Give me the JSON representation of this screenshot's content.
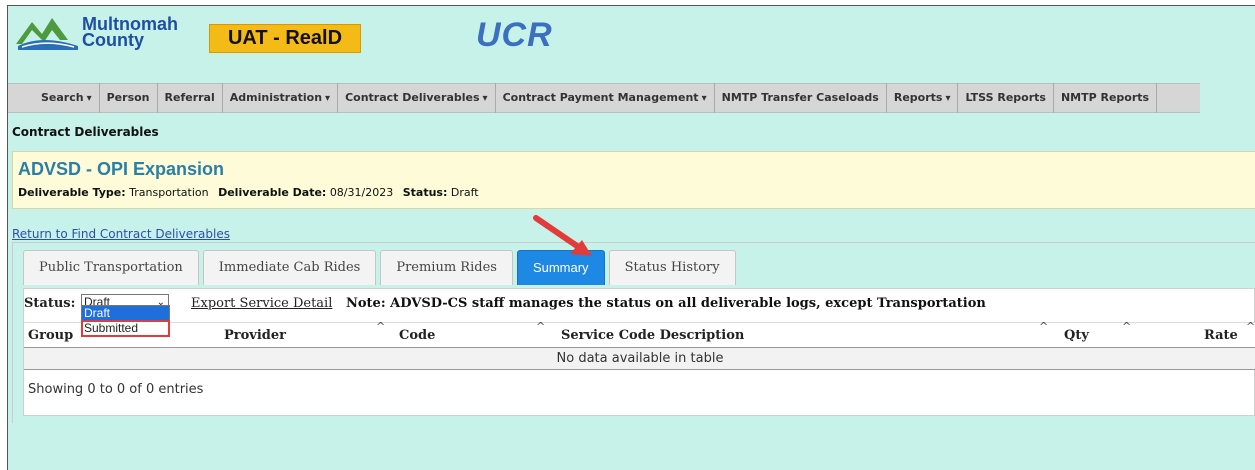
{
  "header": {
    "org_name_line1": "Multnomah",
    "org_name_line2": "County",
    "env_badge": "UAT - RealD",
    "app_title": "UCR"
  },
  "nav": {
    "items": [
      {
        "label": "Search",
        "has_menu": true
      },
      {
        "label": "Person",
        "has_menu": false
      },
      {
        "label": "Referral",
        "has_menu": false
      },
      {
        "label": "Administration",
        "has_menu": true
      },
      {
        "label": "Contract Deliverables",
        "has_menu": true
      },
      {
        "label": "Contract Payment Management",
        "has_menu": true
      },
      {
        "label": "NMTP Transfer Caseloads",
        "has_menu": false
      },
      {
        "label": "Reports",
        "has_menu": true
      },
      {
        "label": "LTSS Reports",
        "has_menu": false
      },
      {
        "label": "NMTP Reports",
        "has_menu": false
      }
    ]
  },
  "page": {
    "heading": "Contract Deliverables",
    "return_link": "Return to Find Contract Deliverables"
  },
  "info": {
    "title": "ADVSD - OPI Expansion",
    "type_label": "Deliverable Type:",
    "type_value": "Transportation",
    "date_label": "Deliverable Date:",
    "date_value": "08/31/2023",
    "status_label": "Status:",
    "status_value": "Draft"
  },
  "tabs": [
    {
      "label": "Public Transportation",
      "active": false
    },
    {
      "label": "Immediate Cab Rides",
      "active": false
    },
    {
      "label": "Premium Rides",
      "active": false
    },
    {
      "label": "Summary",
      "active": true
    },
    {
      "label": "Status History",
      "active": false
    }
  ],
  "summary": {
    "status_label": "Status:",
    "status_selected": "Draft",
    "status_options": [
      "Draft",
      "Submitted"
    ],
    "highlighted_option": "Draft",
    "boxed_option": "Submitted",
    "export_link": "Export Service Detail",
    "note": "Note: ADVSD-CS staff manages the status on all deliverable logs, except Transportation",
    "columns": [
      "Group",
      "Provider",
      "Code",
      "Service Code Description",
      "Qty",
      "Rate"
    ],
    "sort_glyph": "^",
    "empty_message": "No data available in table",
    "footer": "Showing 0 to 0 of 0 entries"
  },
  "icons": {
    "dropdown_caret": "▾",
    "select_arrow": "⌄"
  },
  "colors": {
    "background": "#c7f2ea",
    "env_badge": "#f4ba16",
    "active_tab": "#1e88e5",
    "annotation": "#e23b3b",
    "info_panel": "#fdfbd8"
  }
}
